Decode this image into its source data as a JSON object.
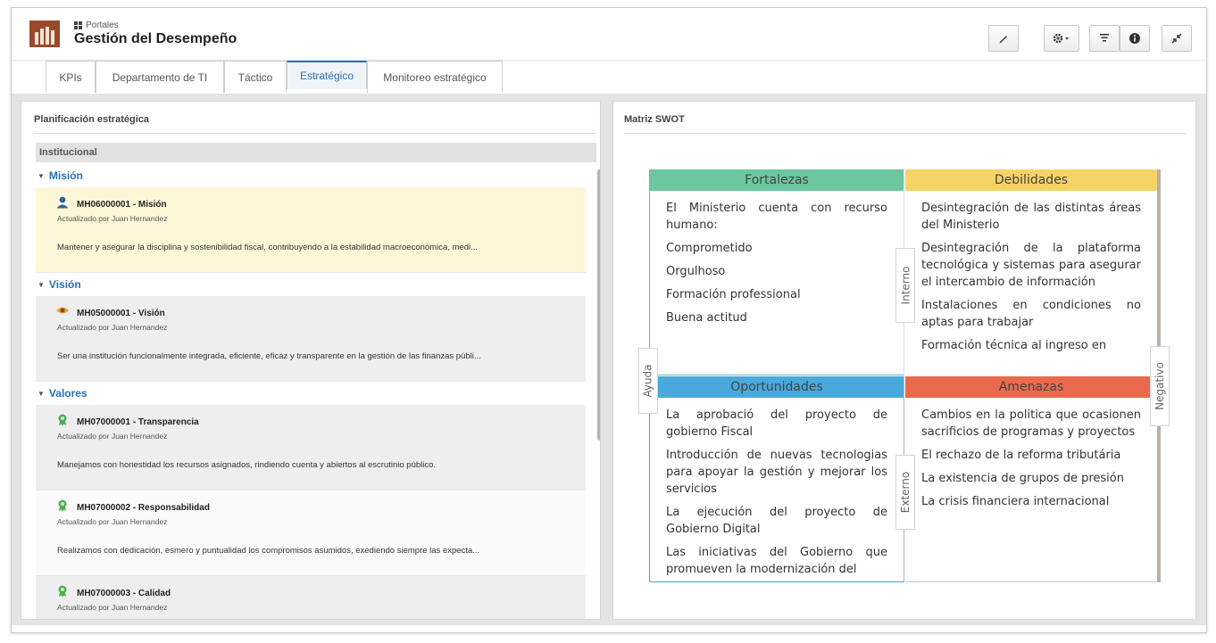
{
  "header": {
    "breadcrumb": "Portales",
    "title": "Gestión del Desempeño"
  },
  "toolbar": {
    "edit_icon": "pencil-icon",
    "settings_icon": "gear-icon",
    "filter_icon": "filter-icon",
    "info_icon": "info-icon",
    "collapse_icon": "collapse-icon"
  },
  "tabs": [
    {
      "label": "KPIs"
    },
    {
      "label": "Departamento de TI"
    },
    {
      "label": "Táctico"
    },
    {
      "label": "Estratégico"
    },
    {
      "label": "Monitoreo estratégico"
    }
  ],
  "left": {
    "title": "Planificación estratégica",
    "group": "Institucional",
    "sections": [
      {
        "label": "Misión"
      },
      {
        "label": "Visión"
      },
      {
        "label": "Valores"
      }
    ],
    "items": [
      {
        "title": "MH06000001 - Misión",
        "sub": "Actualizado por Juan Hernandez",
        "desc": "Mantener y asegurar la disciplina y sostenibilidad fiscal, contribuyendo a la estabilidad macroeconómica, medi..."
      },
      {
        "title": "MH05000001 - Visión",
        "sub": "Actualizado por Juan Hernandez",
        "desc": "Ser una institución funcionalmente integrada, eficiente, eficaz y transparente en la gestión de las finanzas públi..."
      },
      {
        "title": "MH07000001 - Transparencia",
        "sub": "Actualizado por Juan Hernandez",
        "desc": "Manejamos con honestidad los recursos asignados, rindiendo cuenta y abiertos al escrutinio público."
      },
      {
        "title": "MH07000002 - Responsabilidad",
        "sub": "Actualizado por Juan Hernandez",
        "desc": "Realizamos con dedicación, esmero y puntualidad los compromisos asumidos, exediendo siempre las expecta..."
      },
      {
        "title": "MH07000003 - Calidad",
        "sub": "Actualizado por Juan Hernandez",
        "desc": ""
      }
    ]
  },
  "right": {
    "title": "Matriz SWOT",
    "swot": {
      "fortalezas": {
        "title": "Fortalezas",
        "items": [
          "El Ministerio cuenta con recurso humano:",
          "Comprometido",
          "Orgulhoso",
          "Formación professional",
          "Buena actitud"
        ]
      },
      "debilidades": {
        "title": "Debilidades",
        "items": [
          "Desintegración de las distintas áreas del Ministerio",
          "Desintegración de la plataforma tecnológica y sistemas para asegurar el intercambio de información",
          "Instalaciones en condiciones no aptas para trabajar",
          "Formación técnica al ingreso en"
        ]
      },
      "oportunidades": {
        "title": "Oportunidades",
        "items": [
          "La aprobació del proyecto de gobierno Fiscal",
          "Introducción de nuevas tecnologias para apoyar la gestión y mejorar los servicios",
          "La ejecución del proyecto de Gobierno Digital",
          "Las iniciativas del Gobierno que promueven la modernización del"
        ]
      },
      "amenazas": {
        "title": "Amenazas",
        "items": [
          "Cambios en la politica que ocasionen sacrificios de programas y proyectos",
          "El rechazo de la reforma tributária",
          "La existencia de grupos de presión",
          "La crisis financiera internacional"
        ]
      },
      "labels": {
        "interno": "Interno",
        "externo": "Externo",
        "ayuda": "Ayuda",
        "negativo": "Negativo"
      }
    }
  }
}
